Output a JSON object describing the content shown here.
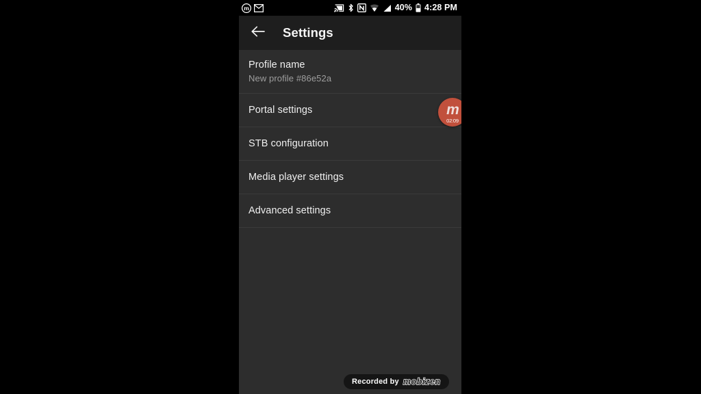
{
  "status_bar": {
    "left_icons": [
      {
        "name": "mobizen-recording-icon",
        "glyph": "m"
      },
      {
        "name": "gmail-icon",
        "glyph": "M"
      }
    ],
    "right_icons": [
      {
        "name": "cast-icon"
      },
      {
        "name": "bluetooth-icon"
      },
      {
        "name": "nfc-icon"
      },
      {
        "name": "wifi-icon"
      },
      {
        "name": "cellular-signal-icon"
      }
    ],
    "battery_percent": "40%",
    "clock": "4:28 PM"
  },
  "toolbar": {
    "back_icon": "arrow-left-icon",
    "title": "Settings"
  },
  "settings_list": [
    {
      "name": "profile-name",
      "title": "Profile name",
      "subtitle": "New profile #86e52a",
      "lines": 2
    },
    {
      "name": "portal-settings",
      "title": "Portal settings",
      "subtitle": "",
      "lines": 1
    },
    {
      "name": "stb-configuration",
      "title": "STB configuration",
      "subtitle": "",
      "lines": 1
    },
    {
      "name": "media-player-settings",
      "title": "Media player settings",
      "subtitle": "",
      "lines": 1
    },
    {
      "name": "advanced-settings",
      "title": "Advanced settings",
      "subtitle": "",
      "lines": 1
    }
  ],
  "mobizen_widget": {
    "logo_letter": "m",
    "timer": "02:09",
    "color": "#c1503c"
  },
  "watermark": {
    "prefix": "Recorded by",
    "brand": "mobizen"
  },
  "colors": {
    "letterbox": "#000000",
    "status_bar_bg": "#000000",
    "toolbar_bg": "#1e1e1e",
    "list_bg": "#2d2d2d",
    "divider": "#3a3a3a",
    "primary_text": "#f0f0f0",
    "secondary_text": "#9e9e9e",
    "accent": "#c1503c"
  }
}
